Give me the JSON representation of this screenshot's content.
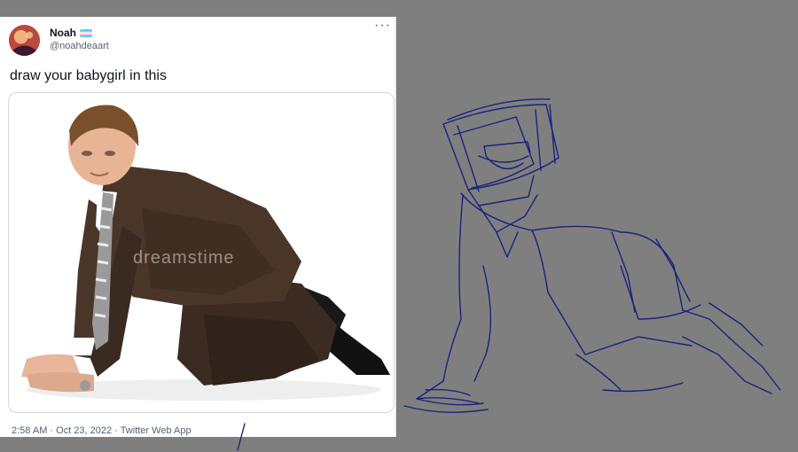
{
  "tweet": {
    "display_name": "Noah",
    "handle": "@noahdeaart",
    "text": "draw your babygirl in this",
    "timestamp": "2:58 AM · Oct 23, 2022 · Twitter Web App",
    "more_icon": "more-horizontal-icon"
  },
  "media": {
    "watermark": "dreamstime"
  },
  "colors": {
    "canvas": "#7f7f7f",
    "sketch_stroke": "#1a237e",
    "card": "#ffffff"
  }
}
